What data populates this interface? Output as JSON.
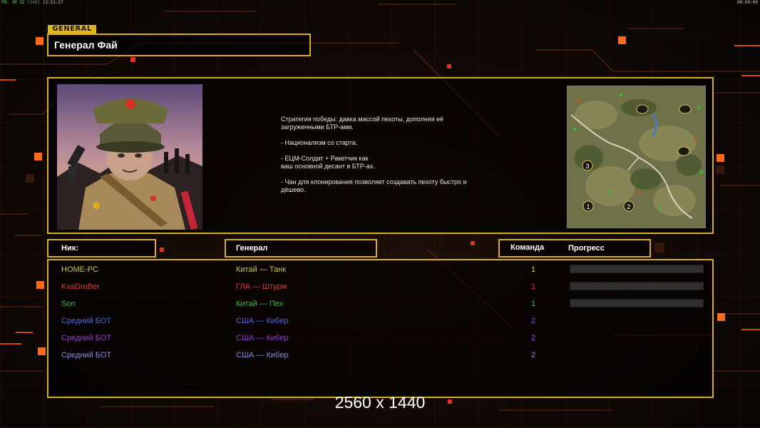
{
  "status_bar": {
    "fps_label": "FR:",
    "fps_values": "30 32",
    "fps_extra": "[240]",
    "clock": "13:51:57",
    "right_clock": "00:00:00"
  },
  "general_tab": "GENERAL",
  "general_name": "Генерал Фай",
  "strategy_text": "Стратегия победы: давка массой пехоты, дополняя её\n загруженными БТР-ами.\n\n- Национализм со старта.\n\n- ЕЦМ-Солдат + Ракетчик как\nваш основной десант в БТР-ах.\n\n- Чан для клонирования позволяет создавать пехоту быстро и\n дёшево.",
  "portrait_icon": "general-fai-portrait",
  "minimap": {
    "icon": "map-preview",
    "start_positions": [
      "1",
      "2",
      "3"
    ]
  },
  "headers": {
    "nick": "Ник:",
    "general": "Генерал",
    "team": "Команда",
    "progress": "Прогресс"
  },
  "players": [
    {
      "nick": "HOME-PC",
      "general": "Китай — Танк",
      "team": "1",
      "color": "#c8c84a",
      "progress": 0
    },
    {
      "nick": "KvaDroBer",
      "general": "ГЛА — Штурм",
      "team": "1",
      "color": "#e23a2a",
      "progress": 0
    },
    {
      "nick": "Son",
      "general": "Китай — Пех",
      "team": "1",
      "color": "#3cb83c",
      "progress": 0
    },
    {
      "nick": "Средний БОТ",
      "general": "США — Кибер",
      "team": "2",
      "color": "#4a68e0",
      "progress": null
    },
    {
      "nick": "Средний БОТ",
      "general": "США — Кибер",
      "team": "2",
      "color": "#9a3ad0",
      "progress": null
    },
    {
      "nick": "Средний БОТ",
      "general": "США — Кибер",
      "team": "2",
      "color": "#8a8ae8",
      "progress": null
    }
  ],
  "resolution_label": "2560 x 1440",
  "colors": {
    "frame": "#d8ad22",
    "accent_orange": "#ff6a1a"
  }
}
